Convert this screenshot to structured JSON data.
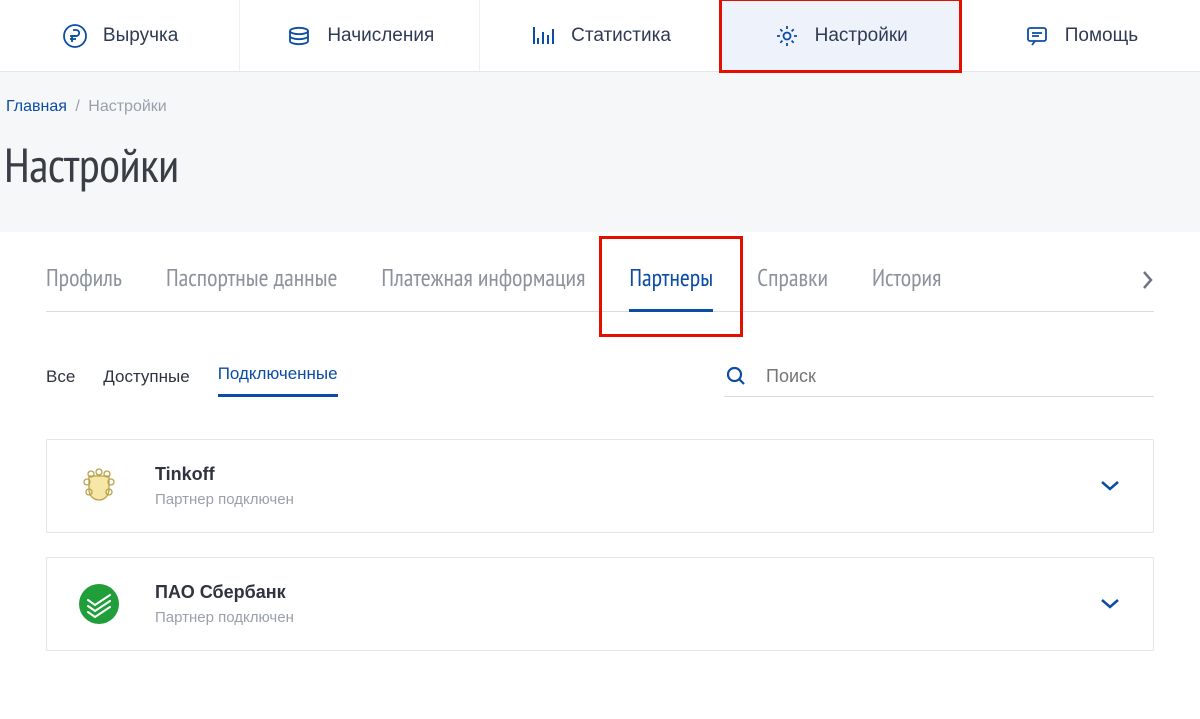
{
  "topnav": [
    {
      "key": "revenue",
      "label": "Выручка",
      "icon": "ruble-icon",
      "active": false
    },
    {
      "key": "accruals",
      "label": "Начисления",
      "icon": "coins-icon",
      "active": false
    },
    {
      "key": "stats",
      "label": "Статистика",
      "icon": "bars-icon",
      "active": false
    },
    {
      "key": "settings",
      "label": "Настройки",
      "icon": "gear-icon",
      "active": true,
      "highlight": true
    },
    {
      "key": "help",
      "label": "Помощь",
      "icon": "chat-icon",
      "active": false
    }
  ],
  "breadcrumb": {
    "home": "Главная",
    "current": "Настройки"
  },
  "page_title": "Настройки",
  "tabs": [
    {
      "key": "profile",
      "label": "Профиль"
    },
    {
      "key": "passport",
      "label": "Паспортные данные"
    },
    {
      "key": "payment",
      "label": "Платежная информация"
    },
    {
      "key": "partners",
      "label": "Партнеры",
      "active": true,
      "highlight": true
    },
    {
      "key": "docs",
      "label": "Справки"
    },
    {
      "key": "history",
      "label": "История"
    }
  ],
  "filter_tabs": [
    {
      "key": "all",
      "label": "Все"
    },
    {
      "key": "available",
      "label": "Доступные"
    },
    {
      "key": "connected",
      "label": "Подключенные",
      "active": true
    }
  ],
  "search": {
    "placeholder": "Поиск"
  },
  "partners": [
    {
      "name": "Tinkoff",
      "status": "Партнер подключен",
      "logo": "tinkoff"
    },
    {
      "name": "ПАО Сбербанк",
      "status": "Партнер подключен",
      "logo": "sber"
    }
  ]
}
